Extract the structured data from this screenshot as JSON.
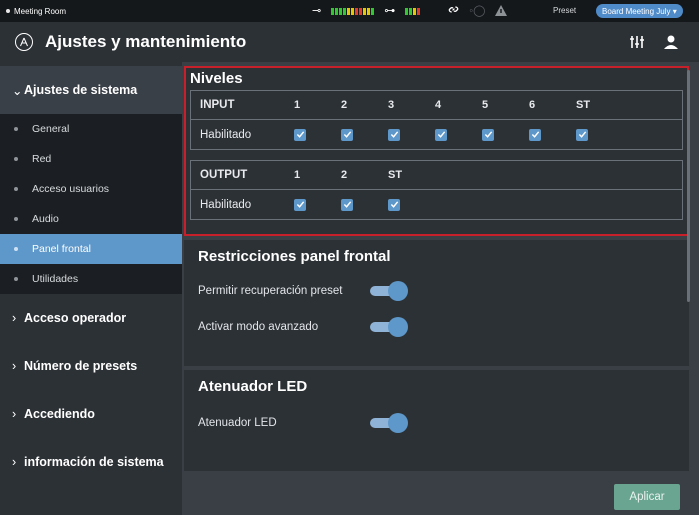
{
  "status_bar": {
    "room": "Meeting Room",
    "preset_label": "Preset",
    "preset_value": "Board Meeting July ▾"
  },
  "header": {
    "title": "Ajustes y mantenimiento"
  },
  "sidebar": {
    "sections": [
      {
        "label": "Ajustes de sistema",
        "open": true
      },
      {
        "label": "Acceso operador"
      },
      {
        "label": "Número de presets"
      },
      {
        "label": "Accediendo"
      },
      {
        "label": "información de sistema"
      }
    ],
    "items": [
      {
        "label": "General"
      },
      {
        "label": "Red"
      },
      {
        "label": "Acceso usuarios"
      },
      {
        "label": "Audio"
      },
      {
        "label": "Panel frontal",
        "active": true
      },
      {
        "label": "Utilidades"
      }
    ]
  },
  "niveles": {
    "title": "Niveles",
    "input": {
      "header": "INPUT",
      "columns": [
        "1",
        "2",
        "3",
        "4",
        "5",
        "6",
        "ST"
      ],
      "row_label": "Habilitado",
      "checked": [
        true,
        true,
        true,
        true,
        true,
        true,
        true
      ]
    },
    "output": {
      "header": "OUTPUT",
      "columns": [
        "1",
        "2",
        "ST"
      ],
      "row_label": "Habilitado",
      "checked": [
        true,
        true,
        true
      ]
    }
  },
  "restricciones": {
    "title": "Restricciones panel frontal",
    "options": [
      {
        "label": "Permitir recuperación preset",
        "on": true
      },
      {
        "label": "Activar modo avanzado",
        "on": true
      }
    ]
  },
  "led": {
    "title": "Atenuador LED",
    "options": [
      {
        "label": "Atenuador LED",
        "on": true
      }
    ]
  },
  "actions": {
    "apply": "Aplicar"
  },
  "colors": {
    "accent": "#5e97c9",
    "highlight_border": "#c8202a",
    "apply_button": "#6aa591"
  }
}
